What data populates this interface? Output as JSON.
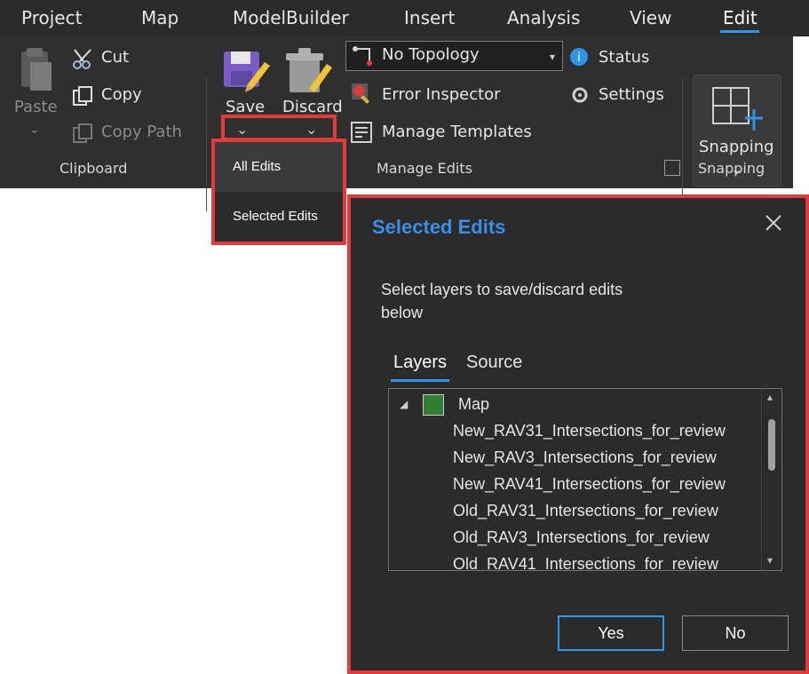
{
  "tabs": [
    {
      "label": "Project"
    },
    {
      "label": "Map"
    },
    {
      "label": "ModelBuilder"
    },
    {
      "label": "Insert"
    },
    {
      "label": "Analysis"
    },
    {
      "label": "View"
    },
    {
      "label": "Edit"
    }
  ],
  "ribbon": {
    "clipboard": {
      "paste_label": "Paste",
      "cut_label": "Cut",
      "copy_label": "Copy",
      "copy_path_label": "Copy Path",
      "group_label": "Clipboard"
    },
    "manage_edits": {
      "save_label": "Save",
      "discard_label": "Discard",
      "topology_value": "No Topology",
      "error_inspector_label": "Error Inspector",
      "manage_templates_label": "Manage Templates",
      "status_label": "Status",
      "settings_label": "Settings",
      "group_label": "Manage Edits"
    },
    "snapping": {
      "button_label": "Snapping",
      "group_label": "Snapping"
    }
  },
  "dropdown": {
    "items": [
      {
        "label": "All Edits"
      },
      {
        "label": "Selected Edits"
      }
    ]
  },
  "dialog": {
    "title": "Selected Edits",
    "description": "Select layers to save/discard edits below",
    "tabs": [
      {
        "label": "Layers"
      },
      {
        "label": "Source"
      }
    ],
    "tree": {
      "root_label": "Map",
      "items": [
        "New_RAV31_Intersections_for_review",
        "New_RAV3_Intersections_for_review",
        "New_RAV41_Intersections_for_review",
        "Old_RAV31_Intersections_for_review",
        "Old_RAV3_Intersections_for_review",
        "Old_RAV41_Intersections_for_review"
      ]
    },
    "buttons": {
      "yes": "Yes",
      "no": "No"
    }
  },
  "colors": {
    "accent": "#2f95e8",
    "highlight_box": "#e23b3b",
    "dialog_title": "#3b8ee8"
  }
}
